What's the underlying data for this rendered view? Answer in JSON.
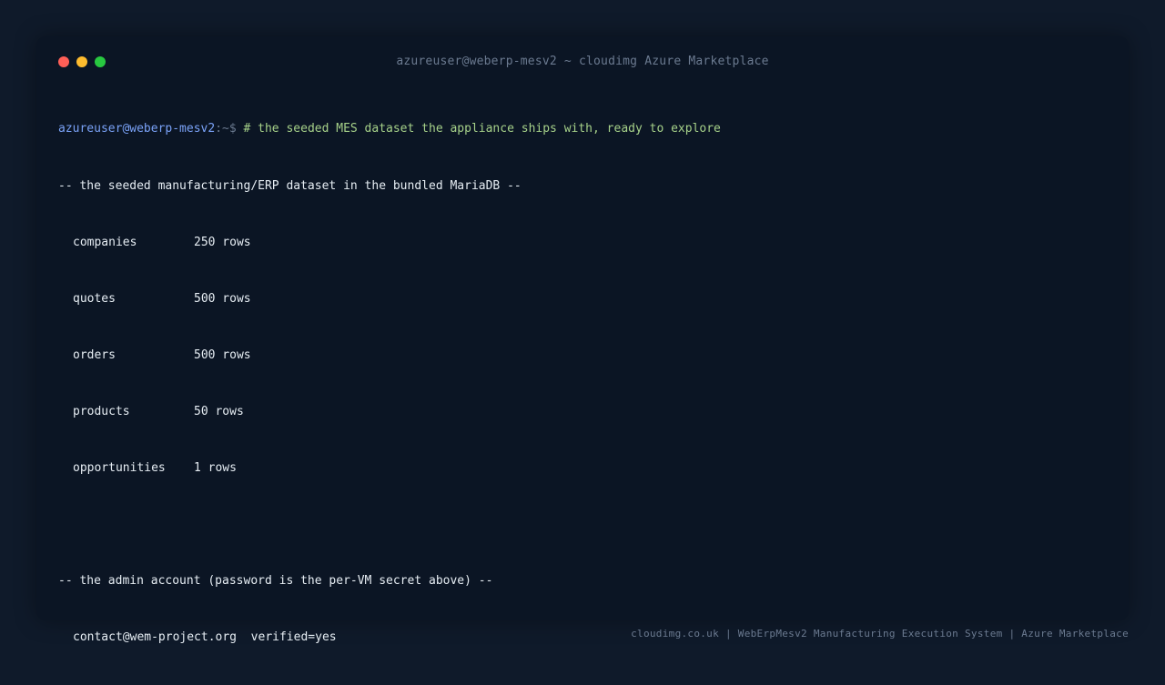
{
  "window": {
    "title": "azureuser@weberp-mesv2 ~ cloudimg Azure Marketplace"
  },
  "terminal": {
    "prompt_user": "azureuser@weberp-mesv2",
    "prompt_path": ":~$",
    "command": "# the seeded MES dataset the appliance ships with, ready to explore",
    "section1_header": "-- the seeded manufacturing/ERP dataset in the bundled MariaDB --",
    "tables": [
      {
        "name": "companies",
        "count": "250 rows"
      },
      {
        "name": "quotes",
        "count": "500 rows"
      },
      {
        "name": "orders",
        "count": "500 rows"
      },
      {
        "name": "products",
        "count": "50 rows"
      },
      {
        "name": "opportunities",
        "count": "1 rows"
      }
    ],
    "section2_header": "-- the admin account (password is the per-VM secret above) --",
    "admin_email": "contact@wem-project.org",
    "admin_status": "verified=yes"
  },
  "footer": {
    "text": "cloudimg.co.uk | WebErpMesv2 Manufacturing Execution System | Azure Marketplace"
  },
  "colors": {
    "background": "#0f1a2a",
    "window": "#0b1524",
    "user": "#7aa2f7",
    "comment": "#a6d189",
    "text": "#e6edf3",
    "muted": "#6b7a90"
  }
}
